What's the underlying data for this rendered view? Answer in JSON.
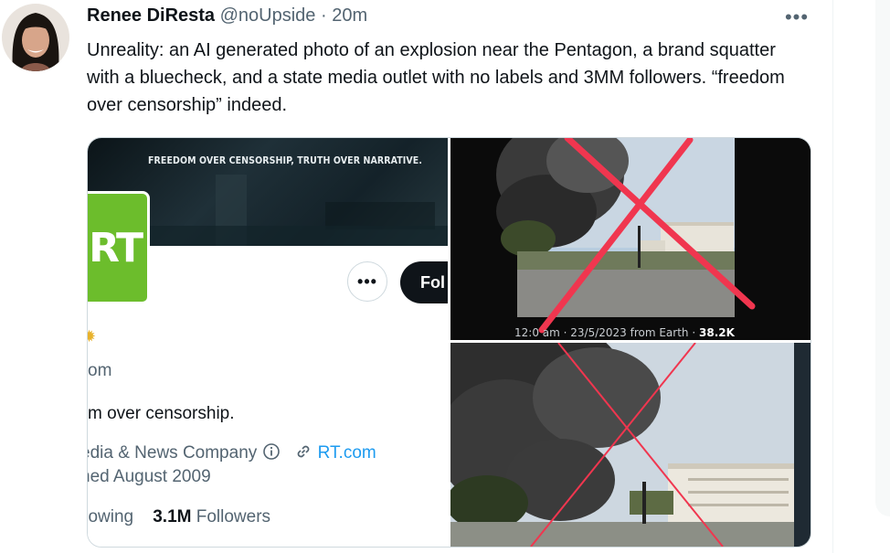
{
  "tweet": {
    "author_name": "Renee DiResta",
    "author_handle": "@noUpside",
    "separator": "·",
    "time": "20m",
    "more_icon": "more-horizontal-icon",
    "text": "Unreality: an AI generated photo of an explosion near the Pentagon, a brand squatter with a bluecheck, and a state media outlet with no labels and 3MM followers. “freedom over censorship” indeed."
  },
  "rt_profile": {
    "banner_text": "FREEDOM OVER CENSORSHIP, TRUTH OVER NARRATIVE.",
    "logo_text": "RT",
    "more_button": "•••",
    "follow_button": "Fol",
    "handle_fragment": "om",
    "bio_fragment": "m over censorship.",
    "category": "edia & News Company",
    "website": "RT.com",
    "joined": "ned August 2009",
    "following_label": "llowing",
    "followers_count": "3.1M",
    "followers_label": "Followers"
  },
  "photo_top": {
    "caption_prefix": "12:0",
    "caption_mid": "am · 23/5/2023 from Earth ·",
    "caption_views": "38.2K"
  },
  "colors": {
    "text": "#0f1419",
    "secondary": "#536471",
    "link": "#1d9bf0",
    "rt_green": "#6cbd2c",
    "cross_red": "#f0364f"
  }
}
